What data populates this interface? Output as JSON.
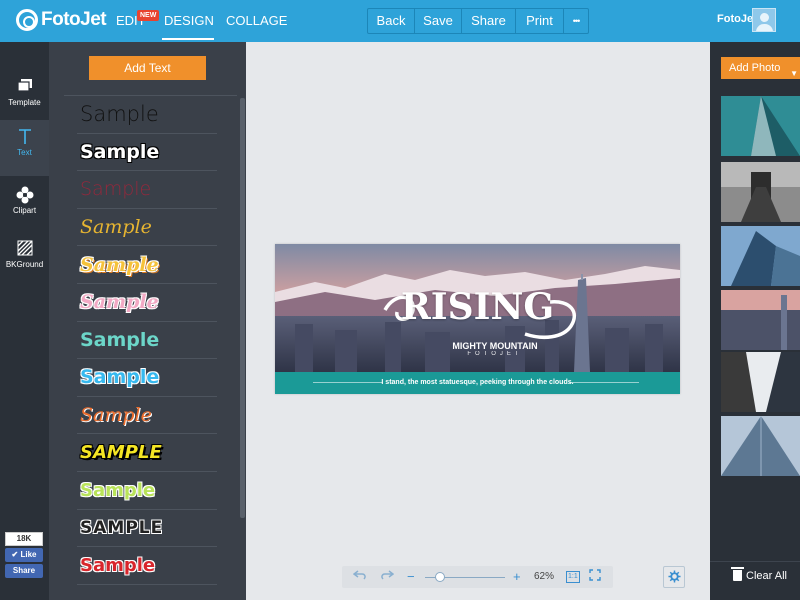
{
  "app": {
    "logo_text": "FotoJet"
  },
  "topnav": {
    "edit": "EDIT",
    "new_badge": "NEW",
    "design": "DESIGN",
    "collage": "COLLAGE"
  },
  "actions": {
    "back": "Back",
    "save": "Save",
    "share": "Share",
    "print": "Print",
    "more": "•••"
  },
  "user": {
    "name": "FotoJet"
  },
  "sidebar": {
    "items": [
      {
        "label": "Template",
        "icon": "template-icon"
      },
      {
        "label": "Text",
        "icon": "text-icon"
      },
      {
        "label": "Clipart",
        "icon": "clipart-icon"
      },
      {
        "label": "BKGround",
        "icon": "background-icon"
      }
    ]
  },
  "social": {
    "count": "18K",
    "like": "✔ Like",
    "share": "Share"
  },
  "text_panel": {
    "add_text": "Add Text",
    "samples": [
      "Sample",
      "Sample",
      "Sample",
      "Sample",
      "Sample",
      "Sample",
      "Sample",
      "Sample",
      "Sample",
      "SAMPLE",
      "Sample",
      "SAMPLE",
      "Sample"
    ]
  },
  "design": {
    "headline": "RISING",
    "subtitle": "MIGHTY MOUNTAIN",
    "brand": "FOTOJET",
    "caption": "I stand, the most statuesque, peeking through the clouds."
  },
  "zoom": {
    "level": "62%",
    "fit_label": "1:1"
  },
  "photo_panel": {
    "add_photo": "Add Photo",
    "clear_all": "Clear All"
  },
  "colors": {
    "topbar": "#2ea3d9",
    "accent": "#f0902b",
    "dark": "#2a3038",
    "panel": "#3a4049",
    "teal": "#1b9a97"
  }
}
